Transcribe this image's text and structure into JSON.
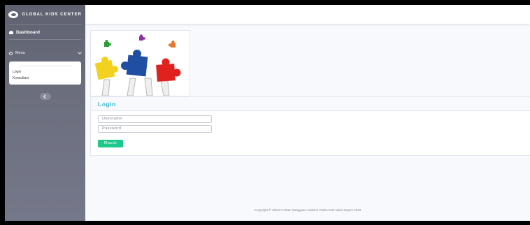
{
  "sidebar": {
    "brand": "GLOBAL KIDS CENTER",
    "dashboard_label": "Dashboard",
    "menu_label": "Menu",
    "submenu": [
      "Login",
      "Konsultasi"
    ]
  },
  "login": {
    "title": "Login",
    "username_placeholder": "Username",
    "password_placeholder": "Password",
    "submit_label": "Masuk"
  },
  "footer": {
    "text": "Copyright © Sistem Pakar Gangguan Autisme Pada Anak Naive Bayes 2023"
  },
  "colors": {
    "sidebar": "#6b6e7d",
    "accent_title": "#36b9cc",
    "button": "#1cc88a",
    "background": "#f8f9fc"
  },
  "icons": [
    "brand-logo-icon",
    "dashboard-icon",
    "gear-icon",
    "chevron-down-icon",
    "chevron-left-icon"
  ]
}
